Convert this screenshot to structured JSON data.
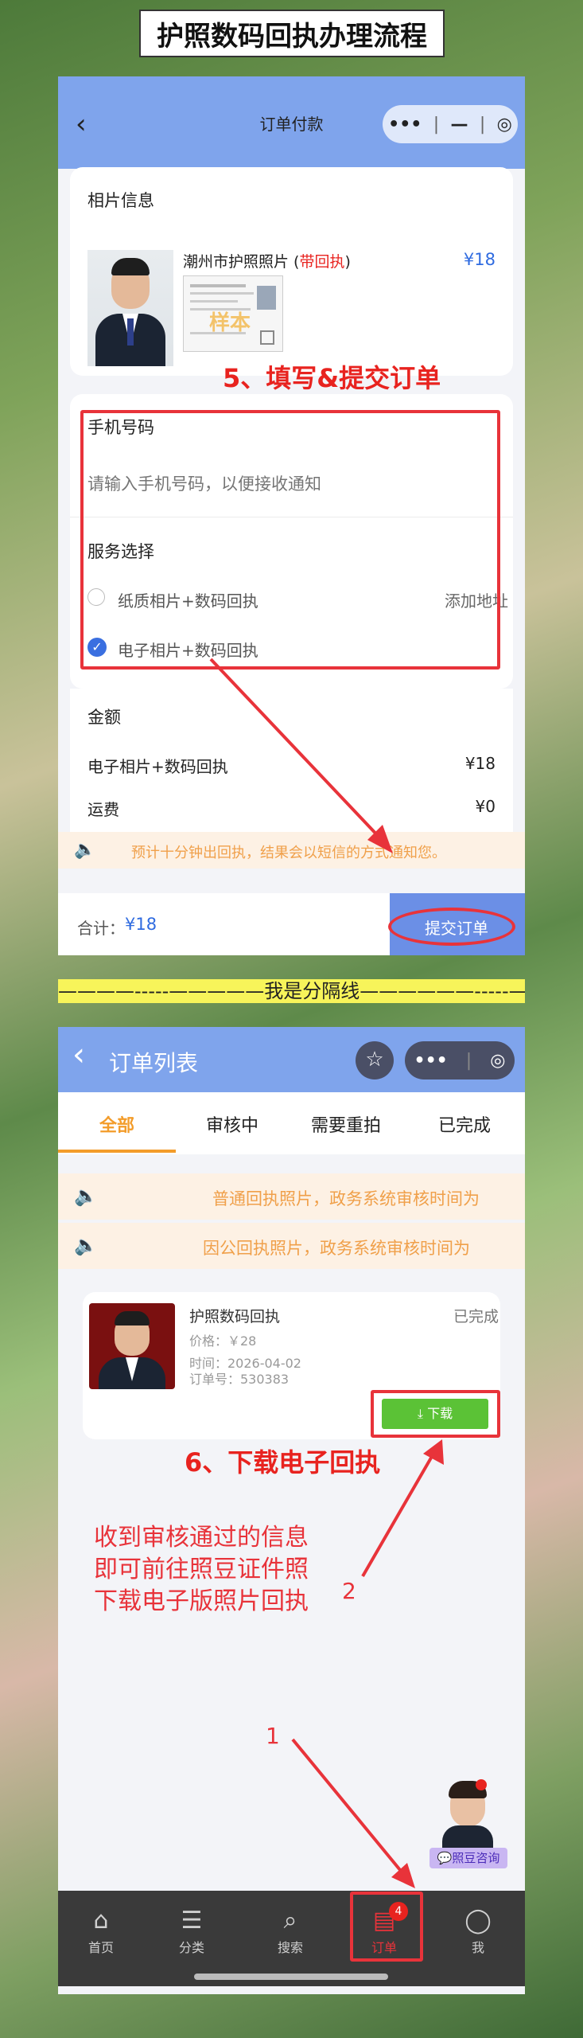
{
  "header_title": "护照数码回执办理流程",
  "order_pay": {
    "nav_title": "订单付款",
    "photo_section_title": "相片信息",
    "product_name": "潮州市护照照片",
    "product_tag_open": " (",
    "product_tag": "带回执",
    "product_tag_close": ")",
    "sample_watermark": "样本",
    "price": "¥18",
    "step5_label": "5、填写&提交订单",
    "phone_label": "手机号码",
    "phone_placeholder": "请输入手机号码，以便接收通知",
    "service_label": "服务选择",
    "option1": "纸质相片+数码回执",
    "option1_action": "添加地址",
    "option2": "电子相片+数码回执",
    "amount_label": "金额",
    "line_item_name": "电子相片+数码回执",
    "line_item_price": "¥18",
    "shipping_label": "运费",
    "shipping_price": "¥0",
    "notice": "预计十分钟出回执，结果会以短信的方式通知您。",
    "total_label": "合计：",
    "total_value": "¥18",
    "submit_label": "提交订单"
  },
  "separator_text": "————-----—————我是分隔线——————-----—————",
  "order_list": {
    "nav_title": "订单列表",
    "tabs": [
      "全部",
      "审核中",
      "需要重拍",
      "已完成"
    ],
    "notice1": "普通回执照片，政务系统审核时间为",
    "notice2": "因公回执照片，政务系统审核时间为",
    "order": {
      "title": "护照数码回执",
      "status": "已完成",
      "price": "价格：￥28",
      "time": "时间：2026-04-02",
      "order_no": "订单号：530383",
      "download_label": "下载"
    },
    "step6_label": "6、下载电子回执",
    "instruction_lines": [
      "收到审核通过的信息",
      "即可前往照豆证件照",
      "下载电子版照片回执"
    ],
    "arrow_num_2": "2",
    "arrow_num_1": "1",
    "consult_label": "照豆咨询",
    "tabbar": [
      {
        "label": "首页",
        "icon": "home-icon"
      },
      {
        "label": "分类",
        "icon": "category-icon"
      },
      {
        "label": "搜索",
        "icon": "search-icon"
      },
      {
        "label": "订单",
        "icon": "order-icon",
        "badge": "4"
      },
      {
        "label": "我",
        "icon": "user-icon"
      }
    ]
  },
  "colors": {
    "nav_blue": "#7fa4ec",
    "accent_red": "#e8231f",
    "price_blue": "#2f6be0",
    "tab_orange": "#f39c2a",
    "download_green": "#5bc236"
  }
}
